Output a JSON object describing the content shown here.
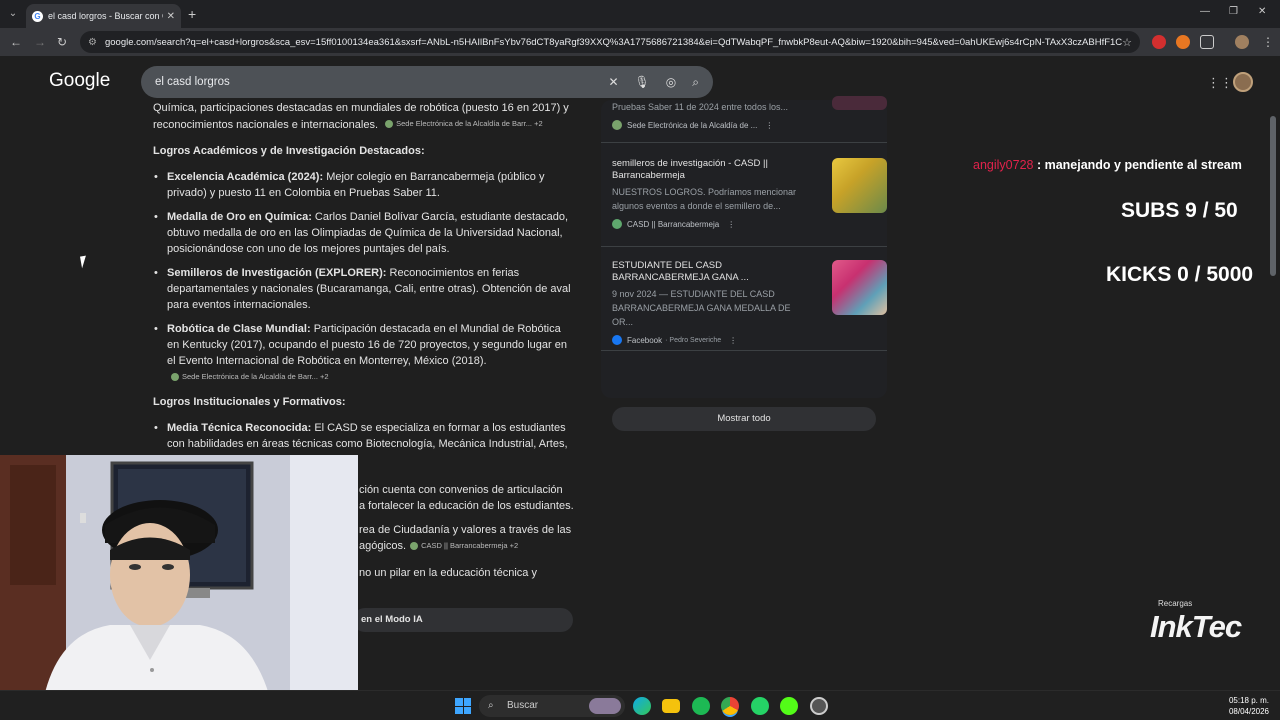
{
  "browser": {
    "tab_title": "el casd lorgros - Buscar con Go",
    "url": "google.com/search?q=el+casd+lorgros&sca_esv=15ff0100134ea361&sxsrf=ANbL-n5HAIlBnFsYbv76dCT8yaRgf39XXQ%3A1775686721384&ei=QdTWabqPF_fnwbkP8eut-AQ&biw=1920&bih=945&ved=0ahUKEwj6s4rCpN-TAxX3czABHfF1C08Q..."
  },
  "google": {
    "logo": "Google",
    "query": "el casd lorgros"
  },
  "overview": {
    "intro": "Química, participaciones destacadas en mundiales de robótica (puesto 16 en 2017) y reconocimientos nacionales e internacionales.",
    "intro_chip": "Sede Electrónica de la Alcaldía de Barr... +2",
    "section1_heading": "Logros Académicos y de Investigación Destacados:",
    "items1": [
      {
        "bold": "Excelencia Académica (2024):",
        "text": " Mejor colegio en Barrancabermeja (público y privado) y puesto 11 en Colombia en Pruebas Saber 11."
      },
      {
        "bold": "Medalla de Oro en Química:",
        "text": " Carlos Daniel Bolívar García, estudiante destacado, obtuvo medalla de oro en las Olimpiadas de Química de la Universidad Nacional, posicionándose con uno de los mejores puntajes del país."
      },
      {
        "bold": "Semilleros de Investigación (EXPLORER):",
        "text": " Reconocimientos en ferias departamentales y nacionales (Bucaramanga, Cali, entre otras). Obtención de aval para eventos internacionales."
      },
      {
        "bold": "Robótica de Clase Mundial:",
        "text": " Participación destacada en el Mundial de Robótica en Kentucky (2017), ocupando el puesto 16 de 720 proyectos, y segundo lugar en el Evento Internacional de Robótica en Monterrey, México (2018).",
        "chip": "Sede Electrónica de la Alcaldía de Barr... +2"
      }
    ],
    "section2_heading": "Logros Institucionales y Formativos:",
    "items2": [
      {
        "bold": "Media Técnica Reconocida:",
        "text": " El CASD se especializa en formar a los estudiantes con habilidades en áreas técnicas como Biotecnología, Mecánica Industrial, Artes,"
      }
    ],
    "fragments": [
      "ción cuenta con convenios de articulación",
      "a fortalecer la educación de los estudiantes.",
      "rea de Ciudadanía y valores a través de las",
      "agógicos.",
      "no un pilar en la educación técnica y"
    ],
    "fragment_chip": "CASD || Barrancabermeja +2",
    "ai_mode_label": "en el Modo IA"
  },
  "sources": [
    {
      "snippet": "Pruebas Saber 11 de 2024 entre todos los...",
      "site": "Sede Electrónica de la Alcaldía de ..."
    },
    {
      "title": "semilleros de investigación - CASD || Barrancabermeja",
      "snippet": "NUESTROS LOGROS. Podríamos mencionar algunos eventos a donde el semillero de...",
      "site": "CASD || Barrancabermeja"
    },
    {
      "title": "ESTUDIANTE DEL CASD BARRANCABERMEJA GANA ...",
      "snippet": "9 nov 2024 — ESTUDIANTE DEL CASD BARRANCABERMEJA GANA MEDALLA DE OR...",
      "site": "Facebook",
      "site_extra": "· Pedro Severiche"
    }
  ],
  "show_all_label": "Mostrar todo",
  "stream": {
    "chat_user": "angily0728",
    "chat_message": " : manejando y pendiente al stream",
    "subs": "SUBS 9 / 50",
    "kicks": "KICKS 0 / 5000",
    "brand_small": "Recargas",
    "brand_big": "InkTec"
  },
  "taskbar": {
    "search_label": "Buscar",
    "time": "05:18 p. m.",
    "date": "08/04/2026"
  },
  "colors": {
    "background": "#1f1f1f",
    "chat_user": "#e0224b",
    "accent": "#3ea6ff"
  }
}
